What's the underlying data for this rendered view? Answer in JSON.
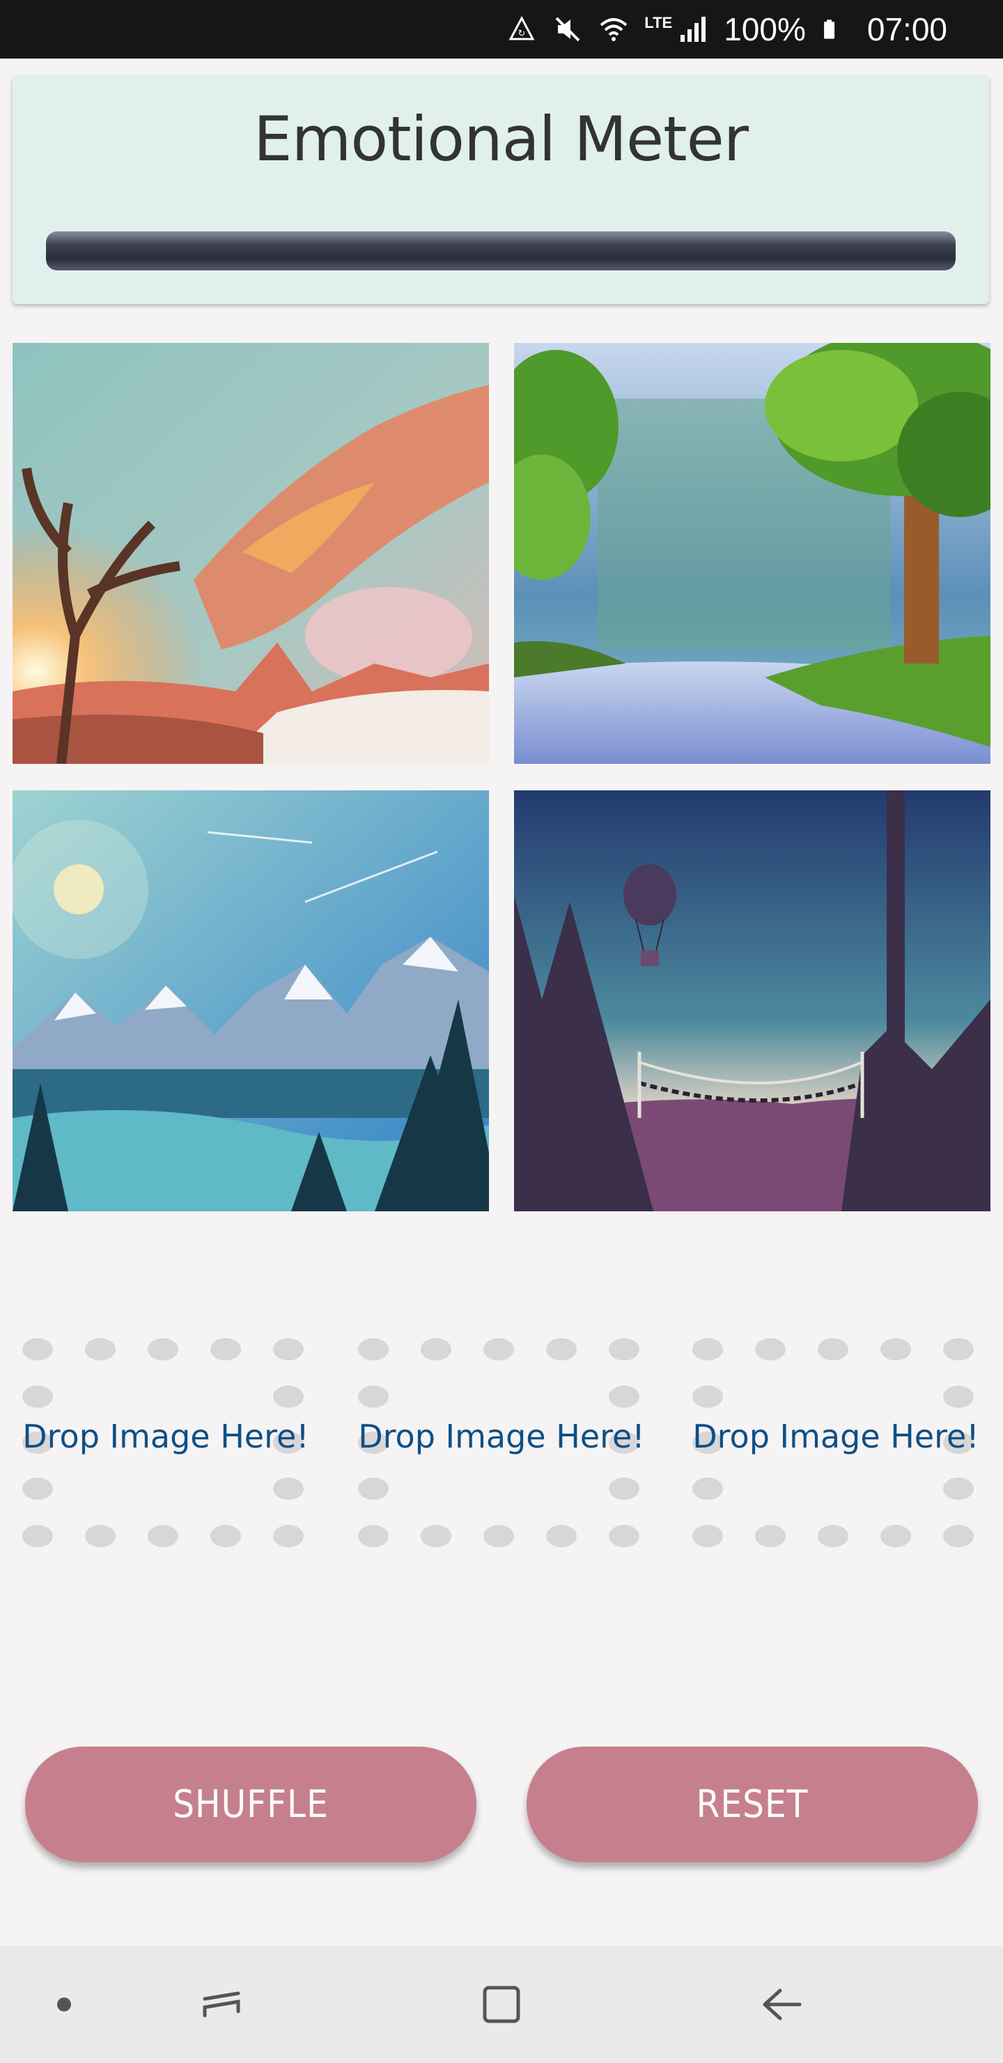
{
  "status_bar": {
    "network": "LTE",
    "battery": "100%",
    "time": "07:00"
  },
  "header": {
    "title": "Emotional Meter"
  },
  "images": [
    {
      "name": "sunset-tree-mountains"
    },
    {
      "name": "forest-river"
    },
    {
      "name": "snowy-mountain-lake"
    },
    {
      "name": "night-rope-bridge-balloon"
    }
  ],
  "drop_zones": [
    {
      "label": "Drop Image Here!"
    },
    {
      "label": "Drop Image Here!"
    },
    {
      "label": "Drop Image Here!"
    }
  ],
  "buttons": {
    "shuffle": "SHUFFLE",
    "reset": "RESET"
  },
  "colors": {
    "header_bg": "#e1f0ec",
    "button_bg": "#c6808d",
    "drop_label": "#0e4f86"
  },
  "icons": [
    "sync-icon",
    "mute-icon",
    "wifi-icon",
    "signal-icon",
    "battery-icon",
    "dot-icon",
    "recents-icon",
    "home-icon",
    "back-icon"
  ]
}
